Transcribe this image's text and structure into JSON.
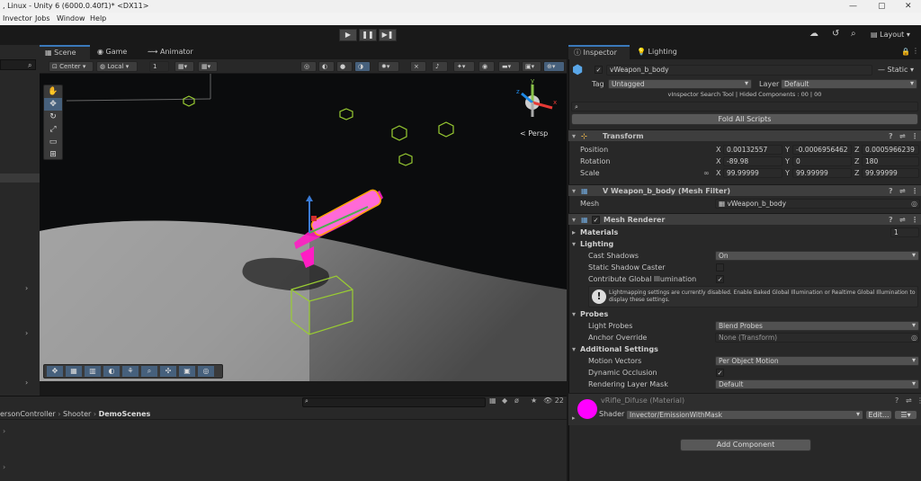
{
  "window": {
    "title": ", Linux - Unity 6 (6000.0.40f1)* <DX11>",
    "controls": [
      "—",
      "▢",
      "✕"
    ]
  },
  "menu": [
    "Invector",
    "Jobs",
    "Window",
    "Help"
  ],
  "toolbar": {
    "play": "▶",
    "pause": "❚❚",
    "step": "▶❚",
    "layout_label": "Layout"
  },
  "scene": {
    "tabs": [
      "Scene",
      "Game",
      "Animator"
    ],
    "pivot_label": "Center",
    "space_label": "Local",
    "grid_value": "1",
    "persp_label": "< Persp",
    "gizmo_axes": [
      "y",
      "x",
      "z"
    ]
  },
  "project": {
    "breadcrumb": [
      "ersonController",
      "Shooter",
      "DemoScenes"
    ],
    "count": "22"
  },
  "inspector": {
    "tabs": [
      "Inspector",
      "Lighting"
    ],
    "object_name": "vWeapon_b_body",
    "static_label": "Static",
    "tag_label": "Tag",
    "tag_value": "Untagged",
    "layer_label": "Layer",
    "layer_value": "Default",
    "search_tool_info": "vInspector Search Tool | Hided Components : 00 | 00",
    "fold_button": "Fold All Scripts",
    "transform": {
      "header": "Transform",
      "rows": [
        {
          "label": "Position",
          "x": "0.00132557",
          "y": "-0.0006956462",
          "z": "0.0005966239"
        },
        {
          "label": "Rotation",
          "x": "-89.98",
          "y": "0",
          "z": "180"
        },
        {
          "label": "Scale",
          "x": "99.99999",
          "y": "99.99999",
          "z": "99.99999"
        }
      ],
      "axes": [
        "X",
        "Y",
        "Z"
      ]
    },
    "mesh_filter": {
      "header": "V Weapon_b_body (Mesh Filter)",
      "mesh_label": "Mesh",
      "mesh_value": "vWeapon_b_body"
    },
    "mesh_renderer": {
      "header": "Mesh Renderer",
      "materials_label": "Materials",
      "materials_count": "1",
      "lighting_label": "Lighting",
      "cast_shadows_label": "Cast Shadows",
      "cast_shadows_value": "On",
      "static_shadow_label": "Static Shadow Caster",
      "contribute_gi_label": "Contribute Global Illumination",
      "lightmap_info_1": "Lightmapping settings are currently disabled. Enable Baked Global Illumination or Realtime Global Illumination to",
      "lightmap_info_2": "display these settings.",
      "probes_label": "Probes",
      "light_probes_label": "Light Probes",
      "light_probes_value": "Blend Probes",
      "anchor_label": "Anchor Override",
      "anchor_value": "None (Transform)",
      "additional_label": "Additional Settings",
      "motion_vectors_label": "Motion Vectors",
      "motion_vectors_value": "Per Object Motion",
      "dynamic_occlusion_label": "Dynamic Occlusion",
      "rendering_layer_label": "Rendering Layer Mask",
      "rendering_layer_value": "Default"
    },
    "material": {
      "name": "vRifle_Difuse (Material)",
      "shader_label": "Shader",
      "shader_value": "Invector/EmissionWithMask",
      "edit_label": "Edit...",
      "color": "#ff00ff"
    },
    "add_component": "Add Component"
  },
  "colors": {
    "accent": "#3a79bb",
    "panel": "#282828",
    "highlight_magenta": "#ff00ff",
    "gizmo_yellow_green": "#9acd32"
  }
}
